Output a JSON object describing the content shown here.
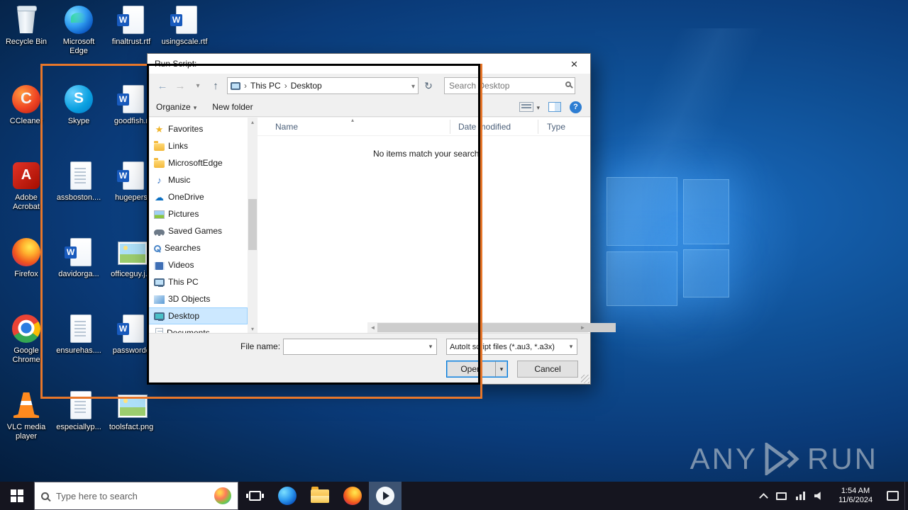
{
  "desktop": {
    "icons": [
      {
        "label": "Recycle Bin",
        "type": "recycle"
      },
      {
        "label": "Microsoft Edge",
        "type": "edge"
      },
      {
        "label": "finaltrust.rtf",
        "type": "word"
      },
      {
        "label": "usingscale.rtf",
        "type": "word"
      },
      {
        "label": "CCleaner",
        "type": "ccleaner"
      },
      {
        "label": "Skype",
        "type": "skype"
      },
      {
        "label": "goodfish.r",
        "type": "word"
      },
      {
        "label": "Adobe Acrobat",
        "type": "acrobat"
      },
      {
        "label": "assboston....",
        "type": "doc"
      },
      {
        "label": "hugepers",
        "type": "word"
      },
      {
        "label": "Firefox",
        "type": "firefox"
      },
      {
        "label": "davidorga...",
        "type": "word"
      },
      {
        "label": "officeguy.j...",
        "type": "image"
      },
      {
        "label": "Google Chrome",
        "type": "chrome"
      },
      {
        "label": "ensurehas....",
        "type": "doc"
      },
      {
        "label": "passwordc",
        "type": "word"
      },
      {
        "label": "VLC media player",
        "type": "vlc"
      },
      {
        "label": "especiallyp...",
        "type": "doc"
      },
      {
        "label": "toolsfact.png",
        "type": "image"
      }
    ]
  },
  "dialog": {
    "title": "Run Script:",
    "address": {
      "segments": [
        "This PC",
        "Desktop"
      ]
    },
    "search": {
      "placeholder": "Search Desktop"
    },
    "toolbar": {
      "organize": "Organize",
      "new_folder": "New folder"
    },
    "sidebar": {
      "selected": "Desktop",
      "items": [
        {
          "label": "Favorites"
        },
        {
          "label": "Links"
        },
        {
          "label": "MicrosoftEdge"
        },
        {
          "label": "Music"
        },
        {
          "label": "OneDrive"
        },
        {
          "label": "Pictures"
        },
        {
          "label": "Saved Games"
        },
        {
          "label": "Searches"
        },
        {
          "label": "Videos"
        },
        {
          "label": "This PC"
        },
        {
          "label": "3D Objects"
        },
        {
          "label": "Desktop"
        },
        {
          "label": "Documents"
        }
      ]
    },
    "list": {
      "columns": [
        "Name",
        "Date modified",
        "Type"
      ],
      "empty_message": "No items match your search."
    },
    "footer": {
      "file_name_label": "File name:",
      "file_name_value": "",
      "file_type_value": "AutoIt script files (*.au3, *.a3x)",
      "open_label": "Open",
      "cancel_label": "Cancel"
    }
  },
  "taskbar": {
    "search_placeholder": "Type here to search",
    "clock_time": "1:54 AM",
    "clock_date": "11/6/2024"
  },
  "watermark": {
    "left": "ANY",
    "right": "RUN"
  },
  "colors": {
    "accent": "#0078d7",
    "highlight_orange": "#e8772a",
    "selection_blue": "#cce8ff"
  }
}
